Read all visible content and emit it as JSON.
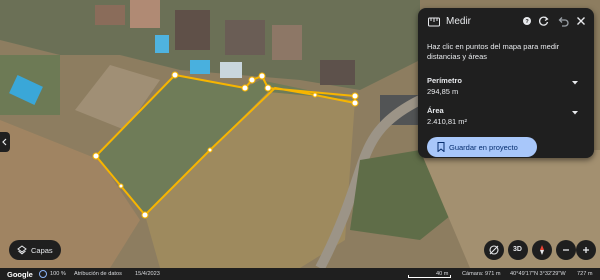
{
  "map": {
    "colors": {
      "field": "#8a7a5c",
      "dry_field": "#a6905f",
      "grass_plot": "#6f7a52",
      "road": "#9c9487",
      "measure_line": "#f7b500",
      "measure_point": "#ffffff"
    }
  },
  "measure_panel": {
    "title": "Medir",
    "icons": [
      "ruler-icon",
      "help-icon",
      "reset-icon",
      "undo-icon",
      "close-icon"
    ],
    "hint": "Haz clic en puntos del mapa para medir distancias y áreas",
    "perimeter_label": "Perímetro",
    "perimeter_value": "294,85 m",
    "area_label": "Área",
    "area_value": "2.410,81 m²",
    "save_label": "Guardar en proyecto"
  },
  "layers": {
    "label": "Capas"
  },
  "controls": {
    "three_d_label": "3D"
  },
  "bottom_bar": {
    "logo": "Google",
    "zoom": "100 %",
    "attribution": "Atribución de datos",
    "date": "15/4/2023",
    "scale": "40 m",
    "camera": "Cámara: 971 m",
    "coords": "40°49'17\"N 3°32'29\"W",
    "elevation": "727 m"
  }
}
